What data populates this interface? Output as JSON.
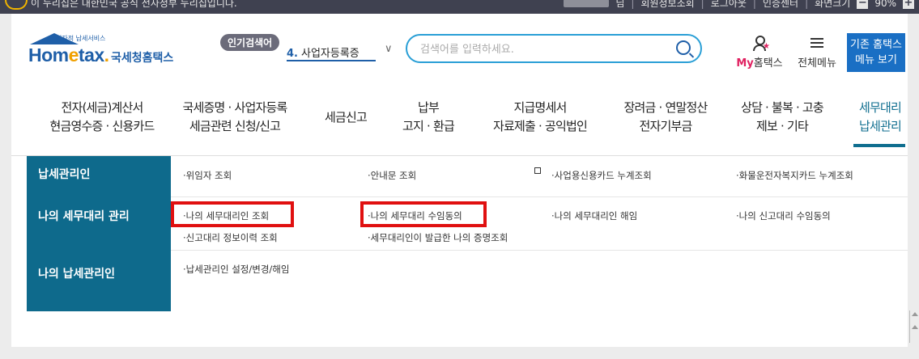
{
  "topbar": {
    "notice": "이 누리집은 대한민국 공식 전자정부 누리집입니다.",
    "user_suffix": "님",
    "links": [
      "회원정보조회",
      "로그아웃",
      "인증센터",
      "화면크기"
    ],
    "zoom_minus": "−",
    "zoom_value": "90%",
    "zoom_plus": "+"
  },
  "header": {
    "logo_small": "전자적 납세서비스",
    "logo_brand_a": "Hom",
    "logo_brand_b": "e",
    "logo_brand_c": "tax",
    "logo_brand_dot": ".",
    "logo_korean": "국세청홈택스",
    "popular_badge": "인기검색어",
    "popular_num": "4.",
    "popular_term": "사업자등록증",
    "search_placeholder": "검색어를 입력하세요.",
    "my_label_en": "My",
    "my_label_ko": "홈택스",
    "allmenu_label": "전체메뉴",
    "old_btn_line1": "기존 홈택스",
    "old_btn_line2": "메뉴 보기"
  },
  "nav": [
    {
      "line1": "전자(세금)계산서",
      "line2": "현금영수증 · 신용카드"
    },
    {
      "line1": "국세증명 · 사업자등록",
      "line2": "세금관련 신청/신고"
    },
    {
      "line1": "세금신고",
      "line2": ""
    },
    {
      "line1": "납부",
      "line2": "고지 · 환급"
    },
    {
      "line1": "지급명세서",
      "line2": "자료제출 · 공익법인"
    },
    {
      "line1": "장려금 · 연말정산",
      "line2": "전자기부금"
    },
    {
      "line1": "상담 · 불복 · 고충",
      "line2": "제보 · 기타"
    },
    {
      "line1": "세무대리",
      "line2": "납세관리"
    }
  ],
  "submenu": {
    "rows": [
      {
        "title": "납세관리인",
        "links": [
          "·위임자 조회",
          "·안내문 조회",
          "·사업용신용카드 누계조회",
          "·화물운전자복지카드 누계조회"
        ]
      },
      {
        "title": "나의 세무대리 관리",
        "links": [
          "·나의 세무대리인 조회",
          "·나의 세무대리 수임동의",
          "·나의 세무대리인 해임",
          "·나의 신고대리 수임동의",
          "·신고대리 정보이력 조회",
          "·세무대리인이 발급한 나의 증명조회"
        ]
      },
      {
        "title": "나의 납세관리인",
        "links": [
          "·납세관리인 설정/변경/해임"
        ]
      }
    ]
  },
  "colors": {
    "brand_blue": "#1f5fa8",
    "teal": "#0e6a8c",
    "highlight_red": "#e01010"
  }
}
